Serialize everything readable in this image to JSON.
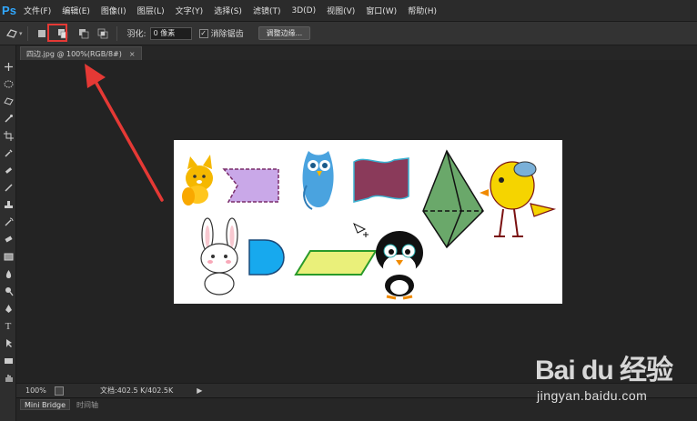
{
  "app": {
    "logo_text": "Ps"
  },
  "menu": {
    "items": [
      {
        "label": "文件(F)"
      },
      {
        "label": "编辑(E)"
      },
      {
        "label": "图像(I)"
      },
      {
        "label": "图层(L)"
      },
      {
        "label": "文字(Y)"
      },
      {
        "label": "选择(S)"
      },
      {
        "label": "滤镜(T)"
      },
      {
        "label": "3D(D)"
      },
      {
        "label": "视图(V)"
      },
      {
        "label": "窗口(W)"
      },
      {
        "label": "帮助(H)"
      }
    ]
  },
  "options": {
    "tool_icon": "polygonal-lasso-icon",
    "mode_icons": [
      "new-selection-icon",
      "add-to-selection-icon",
      "subtract-from-selection-icon",
      "intersect-selection-icon"
    ],
    "active_mode": "add-to-selection-icon",
    "feather_label": "羽化:",
    "feather_value": "0 像素",
    "antialias_label": "消除锯齿",
    "antialias_checked": true,
    "refine_edge_label": "调整边缘..."
  },
  "document": {
    "tab_title": "四边.jpg @ 100%(RGB/8#)",
    "close_glyph": "×"
  },
  "status": {
    "zoom": "100%",
    "doc_size": "文档:402.5 K/402.5K",
    "arrow_glyph": "▶"
  },
  "panels": {
    "tabs": [
      {
        "label": "Mini Bridge"
      },
      {
        "label": "时间轴"
      }
    ]
  },
  "tools": [
    "move-icon",
    "marquee-icon",
    "lasso-icon",
    "quick-select-icon",
    "crop-icon",
    "eyedropper-icon",
    "healing-brush-icon",
    "brush-icon",
    "clone-stamp-icon",
    "history-brush-icon",
    "eraser-icon",
    "gradient-icon",
    "blur-icon",
    "dodge-icon",
    "pen-icon",
    "type-icon",
    "path-select-icon",
    "shape-icon",
    "hand-icon"
  ],
  "annotation": {
    "highlight_color": "#e53935"
  },
  "watermark": {
    "logo": "Bai du 经验",
    "url": "jingyan.baidu.com"
  }
}
